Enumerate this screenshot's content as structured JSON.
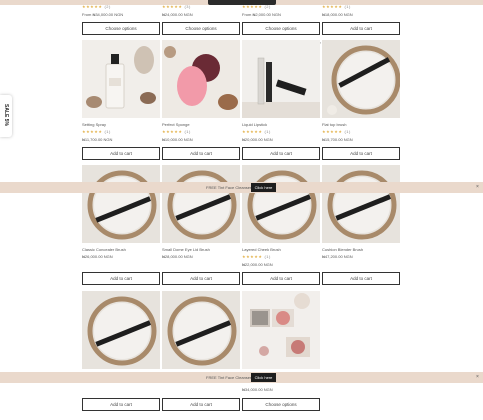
{
  "top_row": [
    {
      "rating": "★★★★★",
      "count": "(2)",
      "price": "From ₦34,000.00 NGN",
      "button": "Choose options"
    },
    {
      "rating": "★★★★★",
      "count": "(3)",
      "price": "₦24,000.00 NGN",
      "button": "Choose options"
    },
    {
      "rating": "★★★★★",
      "count": "(2)",
      "price": "From ₦2,000.00 NGN",
      "button": "Choose options"
    },
    {
      "rating": "★★★★★",
      "count": "(1)",
      "price": "₦18,000.00 NGN",
      "button": "Add to cart"
    }
  ],
  "row2": [
    {
      "name": "Setting Spray",
      "rating": "★★★★★",
      "count": "(1)",
      "price": "₦11,700.00 NGN",
      "button": "Add to cart"
    },
    {
      "name": "Perfect Sponge",
      "rating": "★★★★★",
      "count": "(1)",
      "price": "₦10,000.00 NGN",
      "button": "Add to cart"
    },
    {
      "name": "Liquid Lipstick",
      "rating": "★★★★★",
      "count": "(1)",
      "price": "₦20,000.00 NGN",
      "button": "Add to cart"
    },
    {
      "name": "Flat top brush",
      "rating": "★★★★★",
      "count": "(1)",
      "price": "₦15,700.00 NGN",
      "button": "Add to cart"
    }
  ],
  "row3": [
    {
      "name": "Classic Concealer Brush",
      "price": "₦26,000.00 NGN",
      "button": "Add to cart"
    },
    {
      "name": "Small Dome Eye Lid Brush",
      "price": "₦28,000.00 NGN",
      "button": "Add to cart"
    },
    {
      "name": "Layered Cheek Brush",
      "rating": "★★★★★",
      "count": "(1)",
      "price": "₦22,000.00 NGN",
      "button": "Add to cart"
    },
    {
      "name": "Cushion Blender Brush",
      "price": "₦47,200.00 NGN",
      "button": "Add to cart"
    }
  ],
  "row4": [
    {
      "price": "",
      "button": "Add to cart"
    },
    {
      "price": "",
      "button": "Add to cart"
    },
    {
      "price": "₦34,000.00 NGN",
      "button": "Choose options"
    }
  ],
  "banner": {
    "text": "FREE Tint Face Cleanser",
    "button": "Click here",
    "close": "×"
  },
  "side_tab": "SALE 5%",
  "close_x": "×"
}
